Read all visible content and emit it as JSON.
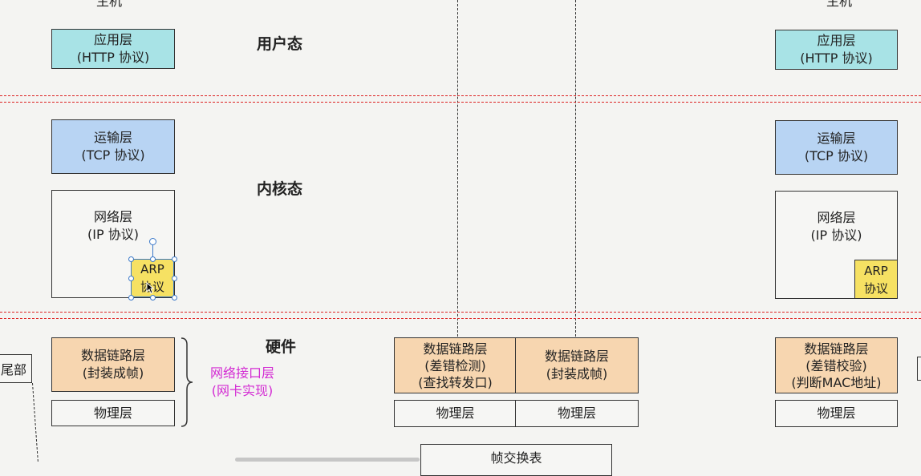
{
  "top_labels": {
    "left": "主机",
    "right": "主机"
  },
  "zones": {
    "user": "用户态",
    "kernel": "内核态",
    "hardware": "硬件"
  },
  "left_host": {
    "app": {
      "line1": "应用层",
      "line2": "(HTTP 协议)"
    },
    "tcp": {
      "line1": "运输层",
      "line2": "(TCP 协议)"
    },
    "ip": {
      "line1": "网络层",
      "line2": "(IP 协议)"
    },
    "arp": {
      "line1": "ARP",
      "line2": "协议"
    },
    "dl": {
      "line1": "数据链路层",
      "line2": "(封装成帧)"
    },
    "phy": "物理层"
  },
  "nic_note": {
    "line1": "网络接口层",
    "line2": "(网卡实现)"
  },
  "left_edge_label": "尾部",
  "switch": {
    "dl_left": {
      "line1": "数据链路层",
      "line2": "(差错检测)",
      "line3": "(查找转发口)"
    },
    "dl_right": {
      "line1": "数据链路层",
      "line2": "(封装成帧)"
    },
    "phy_left": "物理层",
    "phy_right": "物理层",
    "bottom_box": "帧交换表"
  },
  "right_host": {
    "app": {
      "line1": "应用层",
      "line2": "(HTTP 协议)"
    },
    "tcp": {
      "line1": "运输层",
      "line2": "(TCP 协议)"
    },
    "ip": {
      "line1": "网络层",
      "line2": "(IP 协议)"
    },
    "arp": {
      "line1": "ARP",
      "line2": "协议"
    },
    "dl": {
      "line1": "数据链路层",
      "line2": "(差错校验)",
      "line3": "(判断MAC地址)"
    },
    "phy": "物理层"
  },
  "colors": {
    "app": "#a8e3e6",
    "tcp": "#b8d4f3",
    "dl": "#f7d6b0",
    "arp": "#f6e163",
    "boundary": "#dd2222",
    "nic_text": "#d32bd3"
  }
}
